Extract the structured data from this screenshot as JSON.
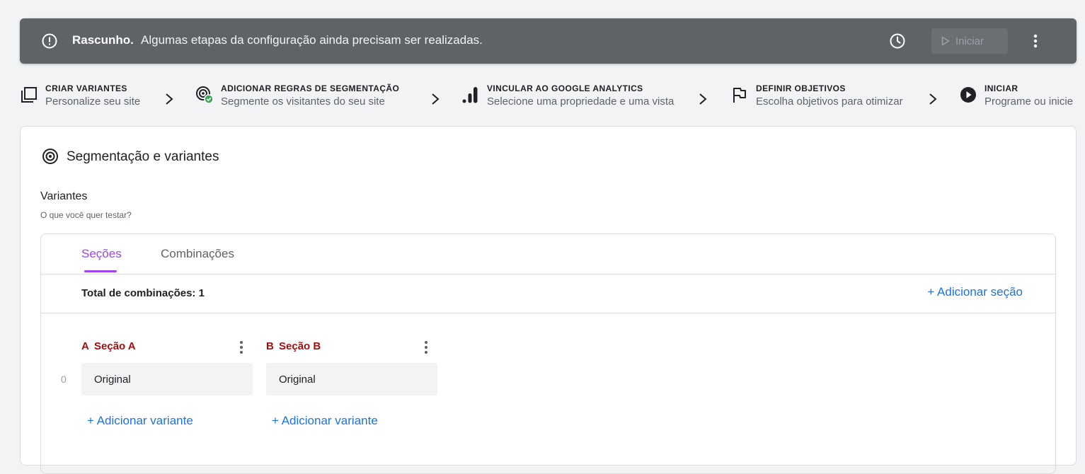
{
  "banner": {
    "title": "Rascunho.",
    "message": "Algumas etapas da configuração ainda precisam ser realizadas.",
    "start_label": "Iniciar"
  },
  "steps": [
    {
      "title": "CRIAR VARIANTES",
      "subtitle": "Personalize seu site",
      "icon": "copy-icon"
    },
    {
      "title": "ADICIONAR REGRAS DE SEGMENTAÇÃO",
      "subtitle": "Segmente os visitantes do seu site",
      "icon": "target-check-icon"
    },
    {
      "title": "VINCULAR AO GOOGLE ANALYTICS",
      "subtitle": "Selecione uma propriedade e uma vista",
      "icon": "analytics-icon"
    },
    {
      "title": "DEFINIR OBJETIVOS",
      "subtitle": "Escolha objetivos para otimizar",
      "icon": "flag-icon"
    },
    {
      "title": "INICIAR",
      "subtitle": "Programe ou inicie",
      "icon": "play-circle-icon"
    }
  ],
  "card": {
    "title": "Segmentação e variantes",
    "variants_label": "Variantes",
    "variants_sub": "O que você quer testar?"
  },
  "tabs": [
    {
      "label": "Seções",
      "active": true
    },
    {
      "label": "Combinações",
      "active": false
    }
  ],
  "total_label": "Total de combinações: 1",
  "add_section_label": "+ Adicionar seção",
  "row_index": "0",
  "sections": [
    {
      "letter": "A",
      "name": "Seção A",
      "variant": "Original",
      "add_label": "+ Adicionar variante"
    },
    {
      "letter": "B",
      "name": "Seção B",
      "variant": "Original",
      "add_label": "+ Adicionar variante"
    }
  ],
  "colors": {
    "banner_bg": "#5f6368",
    "accent_purple": "#a142f4",
    "link_blue": "#1a73e8",
    "section_red": "#a50e0e",
    "success_green": "#34a853"
  }
}
